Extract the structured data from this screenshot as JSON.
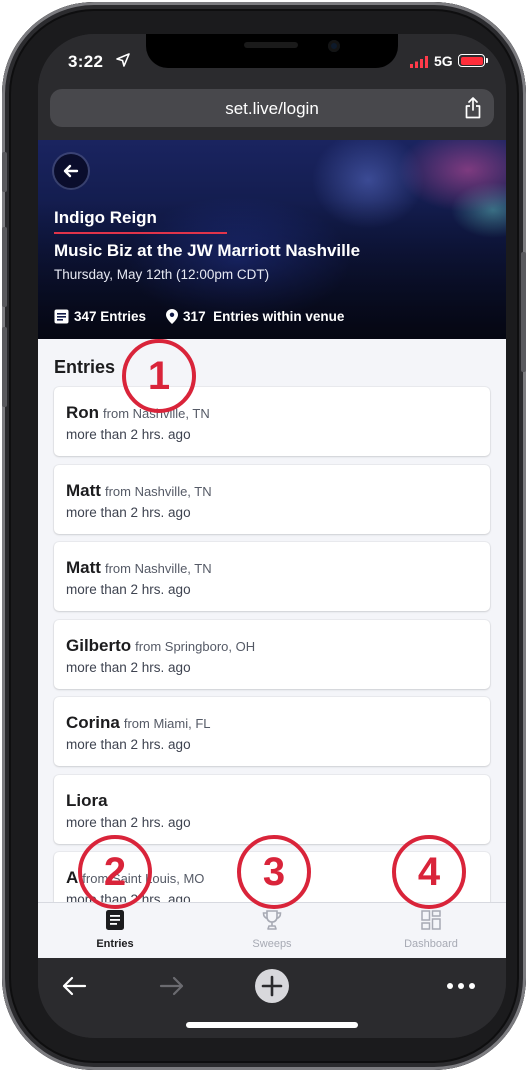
{
  "status": {
    "time": "3:22",
    "network": "5G",
    "battery_color": "#ff2d3a"
  },
  "browser": {
    "url": "set.live/login"
  },
  "event": {
    "artist": "Indigo Reign",
    "title": "Music Biz at the JW Marriott Nashville",
    "date": "Thursday, May 12th (12:00pm CDT)",
    "entries_count": "347 Entries",
    "venue_entries": "317  Entries within venue"
  },
  "entries_section": {
    "title": "Entries"
  },
  "entries": [
    {
      "name": "Ron",
      "location": "from Nashville, TN",
      "time": "more than 2 hrs. ago"
    },
    {
      "name": "Matt",
      "location": "from Nashville, TN",
      "time": "more than 2 hrs. ago"
    },
    {
      "name": "Matt",
      "location": "from Nashville, TN",
      "time": "more than 2 hrs. ago"
    },
    {
      "name": "Gilberto",
      "location": "from Springboro, OH",
      "time": "more than 2 hrs. ago"
    },
    {
      "name": "Corina",
      "location": "from Miami, FL",
      "time": "more than 2 hrs. ago"
    },
    {
      "name": "Liora",
      "location": "",
      "time": "more than 2 hrs. ago"
    },
    {
      "name": "A",
      "location": "from Saint Louis, MO",
      "time": "more than 2 hrs. ago"
    }
  ],
  "markers": [
    "1",
    "2",
    "3",
    "4"
  ],
  "tabs": [
    {
      "label": "Entries",
      "icon": "entries-icon",
      "active": true
    },
    {
      "label": "Sweeps",
      "icon": "trophy-icon",
      "active": false
    },
    {
      "label": "Dashboard",
      "icon": "dashboard-icon",
      "active": false
    }
  ],
  "colors": {
    "accent": "#d9243a",
    "hero_navy": "#111a48"
  }
}
